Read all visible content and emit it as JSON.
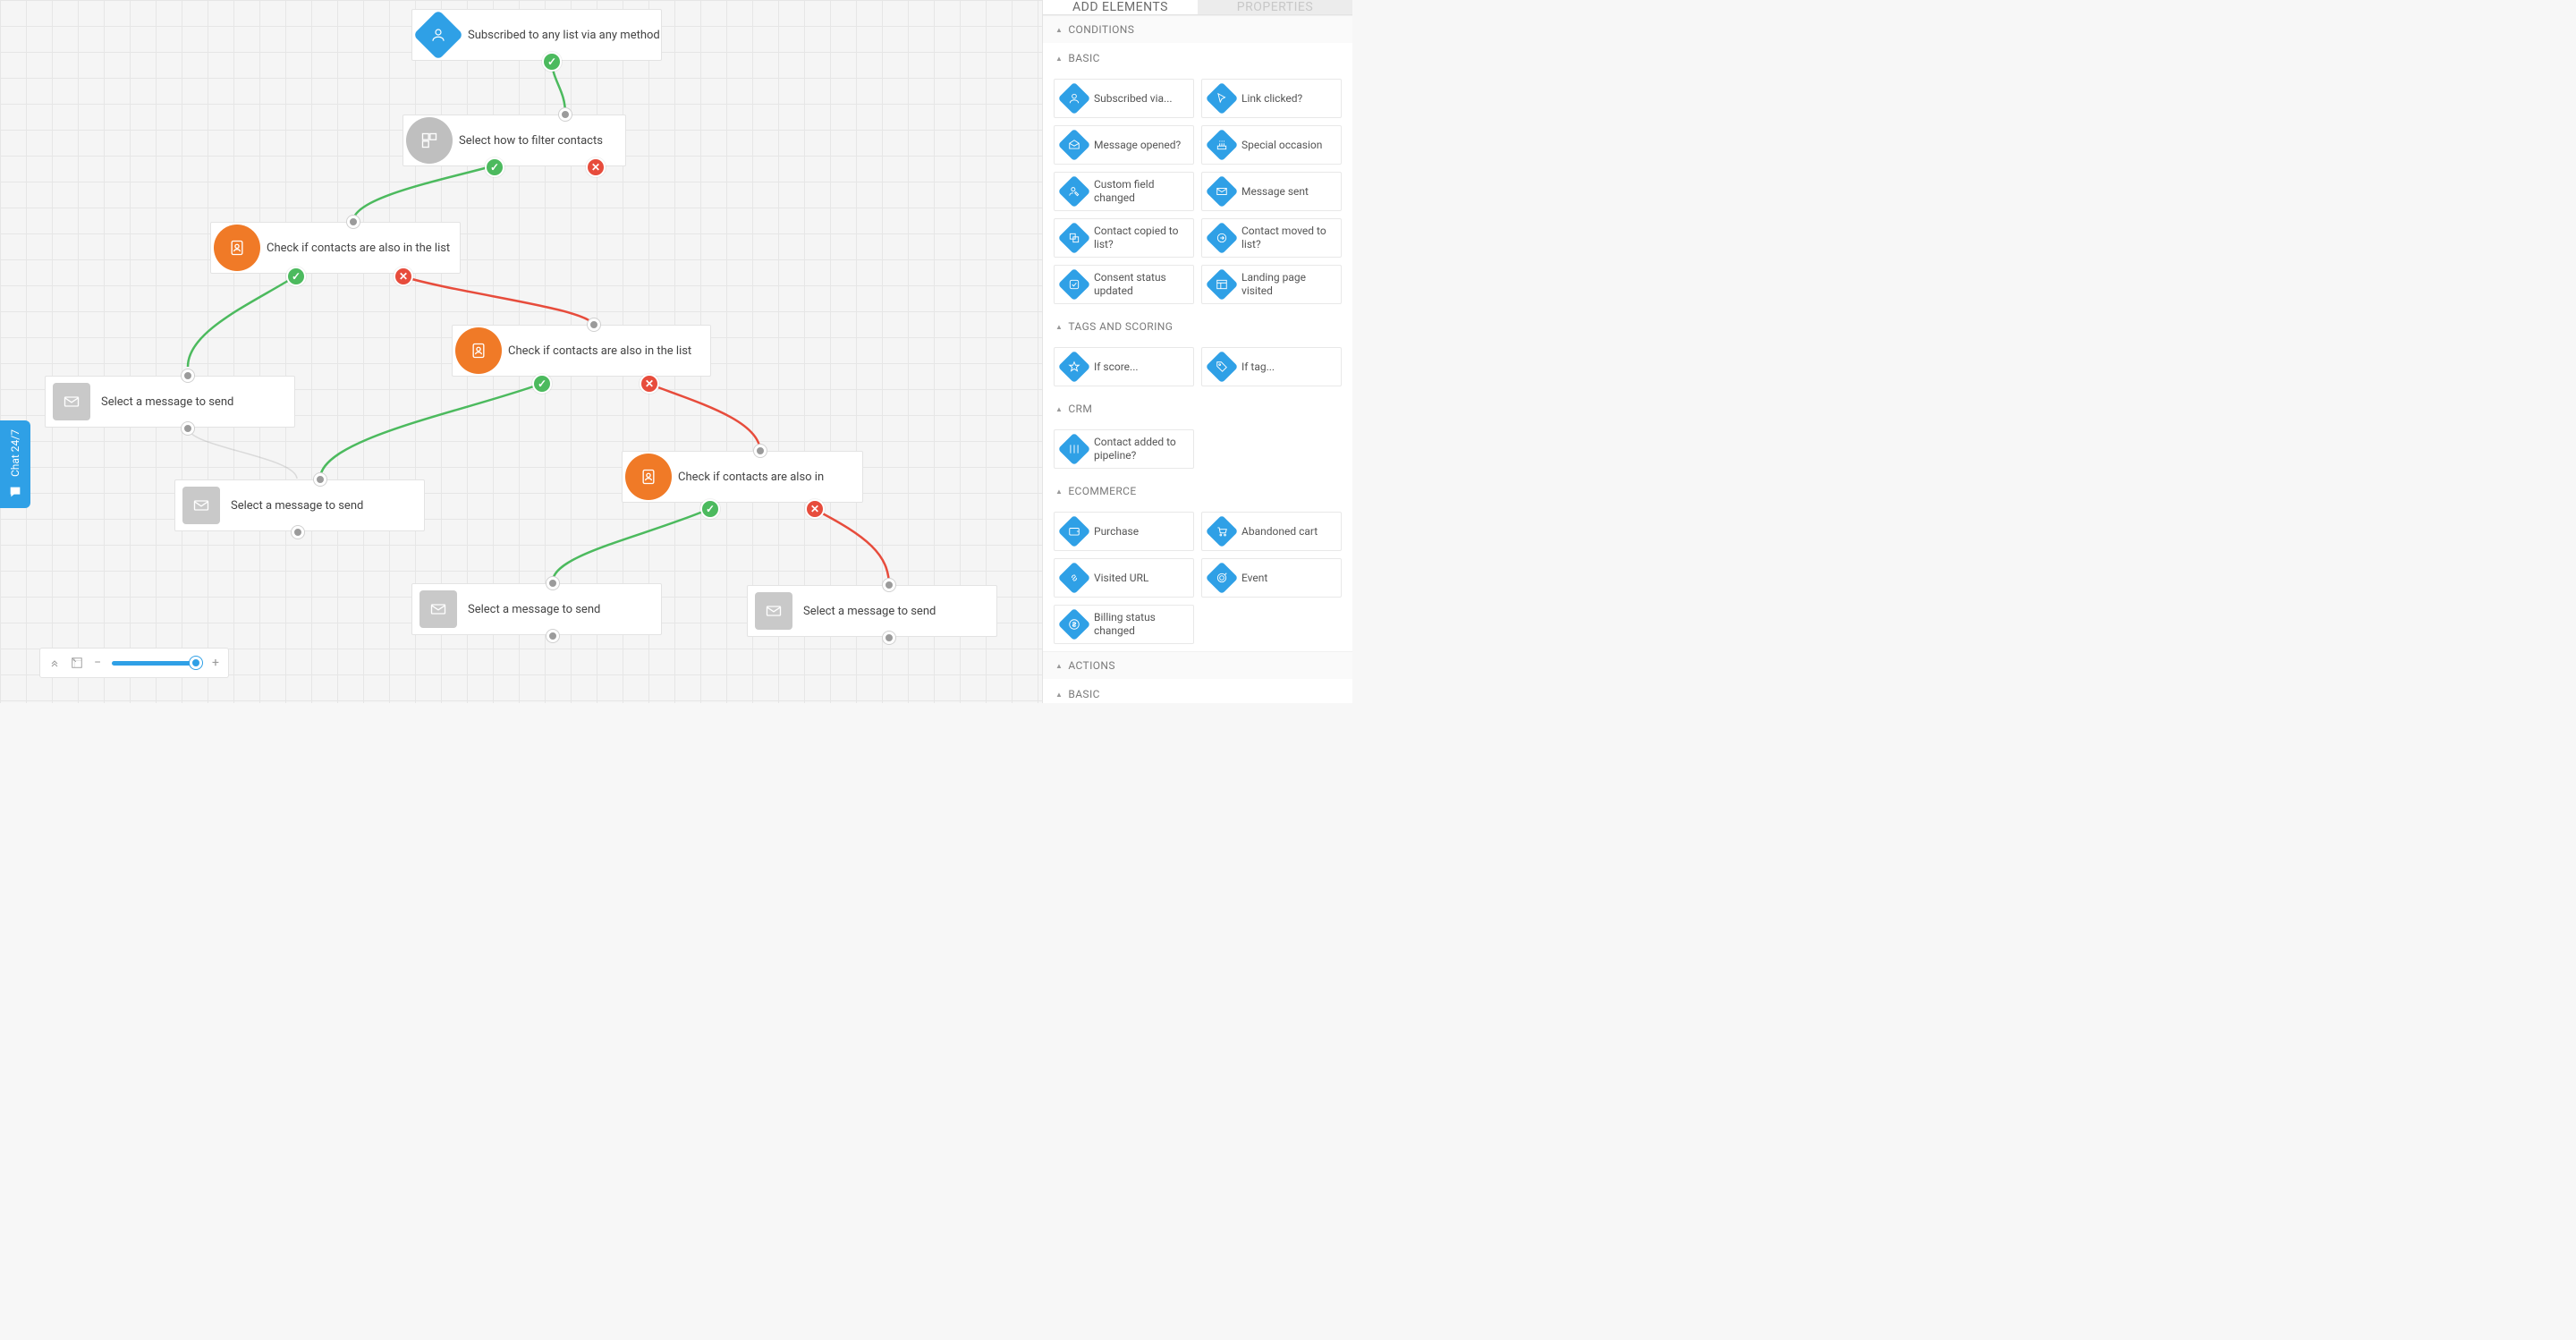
{
  "chat_tab": {
    "label": "Chat 24/7"
  },
  "tabs": {
    "add": "ADD ELEMENTS",
    "properties": "PROPERTIES"
  },
  "sidebar": {
    "conditions_header": "CONDITIONS",
    "basic_header": "BASIC",
    "tags_header": "TAGS AND SCORING",
    "crm_header": "CRM",
    "ecom_header": "ECOMMERCE",
    "actions_header": "ACTIONS",
    "actions_basic_header": "BASIC",
    "items": {
      "subscribed_via": "Subscribed via...",
      "link_clicked": "Link clicked?",
      "message_opened": "Message opened?",
      "special_occasion": "Special occasion",
      "custom_field": "Custom field changed",
      "message_sent": "Message sent",
      "contact_copied": "Contact copied to list?",
      "contact_moved": "Contact moved to list?",
      "consent_status": "Consent status updated",
      "landing_visited": "Landing page visited",
      "if_score": "If score...",
      "if_tag": "If tag...",
      "pipeline": "Contact added to pipeline?",
      "purchase": "Purchase",
      "abandoned": "Abandoned cart",
      "visited_url": "Visited URL",
      "event": "Event",
      "billing": "Billing status changed"
    }
  },
  "nodes": {
    "n1": "Subscribed to any list via any method",
    "n2": "Select how to filter contacts",
    "n3": "Check if contacts are also in the list",
    "n4": "Select a message to send",
    "n5": "Select a message to send",
    "n6": "Check if contacts are also in the list",
    "n7": "Select a message to send",
    "n8": "Check if contacts are also in",
    "n9": "Select a message to send"
  },
  "colors": {
    "blue": "#2fa0e6",
    "orange": "#f07a27",
    "grey": "#bfbfbf",
    "green": "#4cba5e",
    "red": "#e74c3c"
  }
}
